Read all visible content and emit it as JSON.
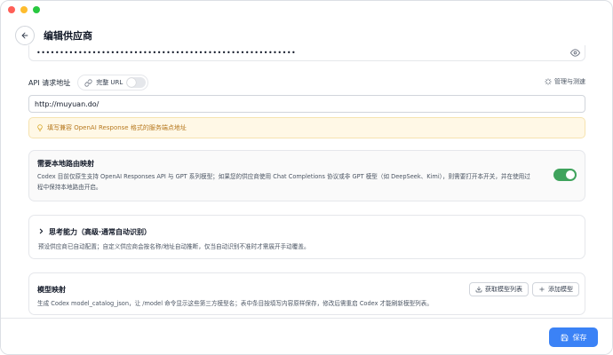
{
  "window": {
    "title": "编辑供应商"
  },
  "header": {
    "back_icon": "arrow-left-icon",
    "title": "编辑供应商"
  },
  "api_key": {
    "masked_value": "••••••••••••••••••••••••••••••••••••••••••••••••••••••••",
    "icon": "eye-icon"
  },
  "api_url": {
    "label": "API 请求地址",
    "full_url_toggle_label": "完整 URL",
    "full_url_enabled": false,
    "manage_test_label": "管理与测速",
    "value": "http://muyuan.do/",
    "hint": "填写兼容 OpenAI Response 格式的服务端点地址"
  },
  "local_routing": {
    "title": "需要本地路由映射",
    "description_line1": "Codex 目前仅原生支持 OpenAI Responses API 与 GPT 系列模型；如果您的供应商使用 Chat Completions 协议或非 GPT 模型（如 DeepSeek、Kimi），则需要打开本开关，并在使用过",
    "description_line2": "程中保持本地路由开启。",
    "enabled": true
  },
  "thinking": {
    "title": "思考能力（高级·通常自动识别）",
    "description": "预设供应商已自动配置；自定义供应商会按名称/地址自动推断，仅当自动识别不准时才需展开手动覆盖。"
  },
  "model_mapping": {
    "title": "模型映射",
    "fetch_button": "获取模型列表",
    "add_button": "添加模型",
    "description": "生成 Codex model_catalog_json，让 /model 命令显示这些第三方模型名；表中条目按填写内容原样保存，修改后需重启 Codex 才能刷新模型列表。"
  },
  "footer": {
    "save_label": "保存"
  },
  "colors": {
    "accent": "#3b82f6",
    "toggle_on": "#3fa35c",
    "hint_bg": "#fff8e6",
    "hint_text": "#b7791f"
  }
}
